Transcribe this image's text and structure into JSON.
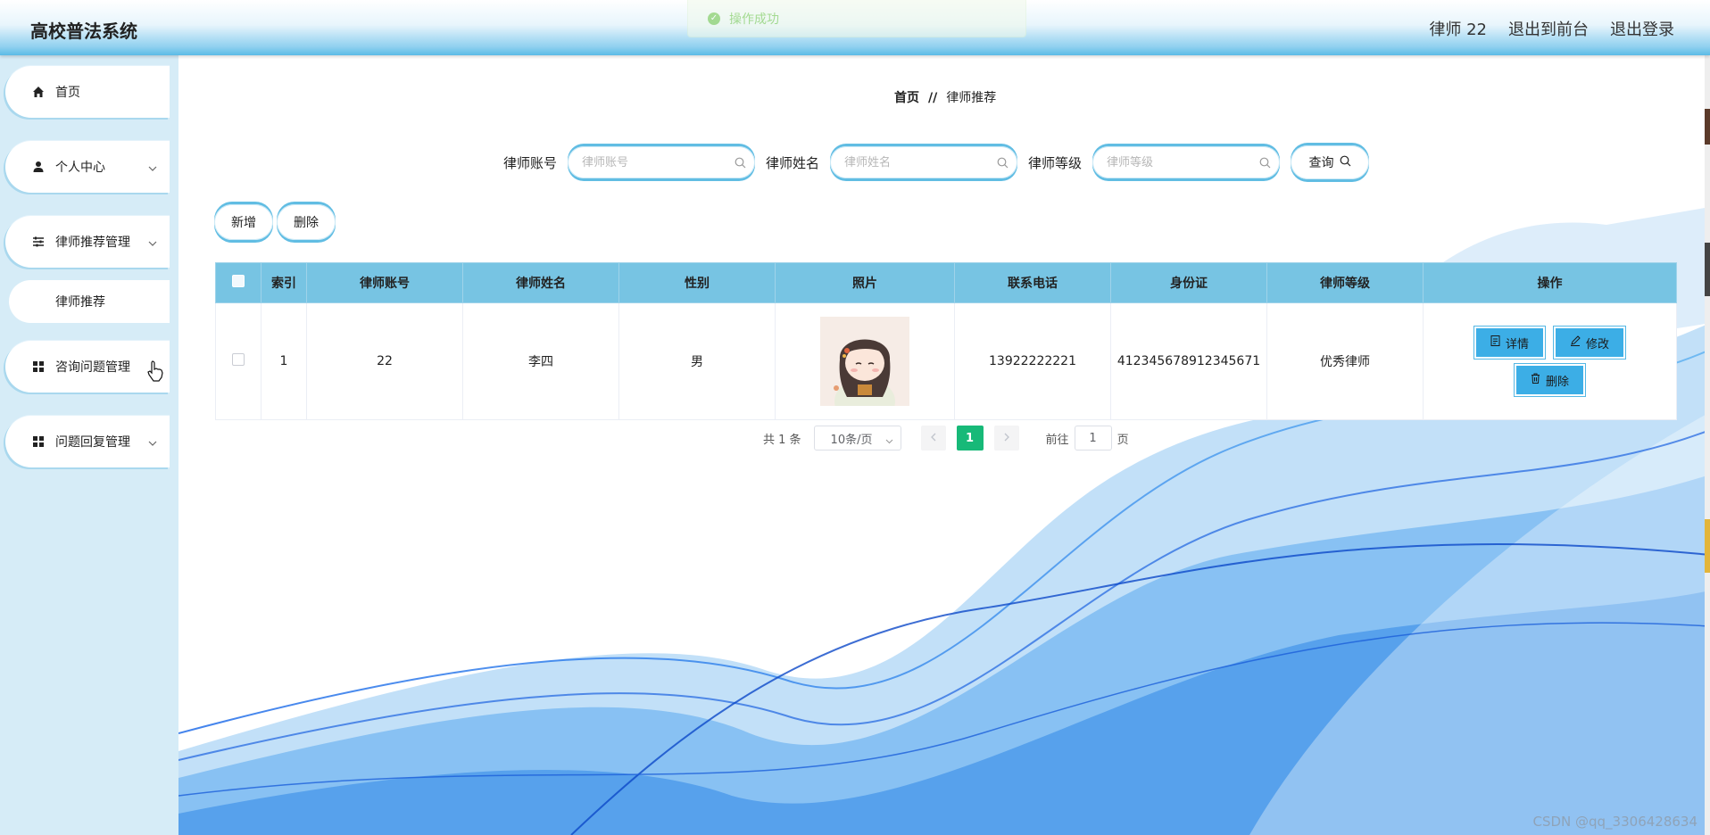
{
  "app": {
    "title": "高校普法系统"
  },
  "header": {
    "user_label": "律师 22",
    "to_front_label": "退出到前台",
    "logout_label": "退出登录"
  },
  "toast": {
    "message": "操作成功"
  },
  "sidebar": {
    "items": [
      {
        "label": "首页",
        "icon": "home-icon"
      },
      {
        "label": "个人中心",
        "icon": "user-icon"
      },
      {
        "label": "律师推荐管理",
        "icon": "sliders-icon"
      },
      {
        "label": "咨询问题管理",
        "icon": "grid-icon"
      },
      {
        "label": "问题回复管理",
        "icon": "grid-icon"
      }
    ],
    "sub_items": [
      {
        "label": "律师推荐"
      }
    ]
  },
  "breadcrumb": {
    "home": "首页",
    "separator": "//",
    "current": "律师推荐"
  },
  "search": {
    "fields": [
      {
        "label": "律师账号",
        "placeholder": "律师账号"
      },
      {
        "label": "律师姓名",
        "placeholder": "律师姓名"
      },
      {
        "label": "律师等级",
        "placeholder": "律师等级"
      }
    ],
    "button_label": "查询"
  },
  "actions": {
    "add_label": "新增",
    "delete_label": "删除"
  },
  "table": {
    "columns": [
      "索引",
      "律师账号",
      "律师姓名",
      "性别",
      "照片",
      "联系电话",
      "身份证",
      "律师等级",
      "操作"
    ],
    "rows": [
      {
        "index": "1",
        "account": "22",
        "name": "李四",
        "gender": "男",
        "phone": "13922222221",
        "id_card": "412345678912345671",
        "level": "优秀律师"
      }
    ],
    "ops": {
      "detail_label": "详情",
      "edit_label": "修改",
      "delete_label": "删除"
    }
  },
  "pagination": {
    "total": "共 1 条",
    "page_size": "10条/页",
    "current_page": "1",
    "goto_prefix": "前往",
    "goto_value": "1",
    "goto_suffix": "页"
  },
  "watermark": "CSDN @qq_3306428634",
  "colors": {
    "header_blue": "#5bbbe6",
    "table_header": "#77c4e3",
    "op_button": "#3caee6",
    "active_page": "#17b978",
    "sidebar_bg": "#d6ecf7"
  }
}
